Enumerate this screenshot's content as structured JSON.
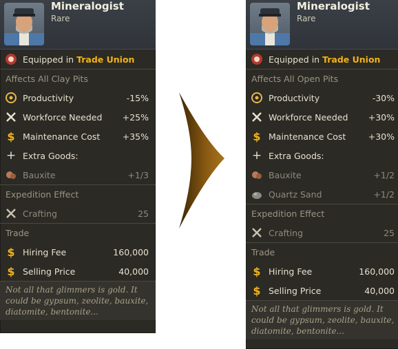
{
  "left": {
    "name": "Mineralogist",
    "rarity": "Rare",
    "equipped_prefix": "Equipped in",
    "equipped_target": "Trade Union",
    "affects": "Affects All Clay Pits",
    "stats": [
      {
        "label": "Productivity",
        "value": "-15%",
        "icon": "gear-icon"
      },
      {
        "label": "Workforce Needed",
        "value": "+25%",
        "icon": "hammer-wrench-icon"
      },
      {
        "label": "Maintenance Cost",
        "value": "+35%",
        "icon": "dollar-icon"
      }
    ],
    "extra_goods_label": "Extra Goods:",
    "goods": [
      {
        "label": "Bauxite",
        "value": "+1/3",
        "icon": "bauxite-icon"
      }
    ],
    "expedition_label": "Expedition Effect",
    "expedition": {
      "label": "Crafting",
      "value": "25"
    },
    "trade_label": "Trade",
    "hiring_fee_label": "Hiring Fee",
    "hiring_fee": "160,000",
    "selling_price_label": "Selling Price",
    "selling_price": "40,000",
    "flavor": "Not all that glimmers is gold. It could be gypsum, zeolite, bauxite, diatomite, bentonite..."
  },
  "right": {
    "name": "Mineralogist",
    "rarity": "Rare",
    "equipped_prefix": "Equipped in",
    "equipped_target": "Trade Union",
    "affects": "Affects All Open Pits",
    "stats": [
      {
        "label": "Productivity",
        "value": "-30%",
        "icon": "gear-icon"
      },
      {
        "label": "Workforce Needed",
        "value": "+30%",
        "icon": "hammer-wrench-icon"
      },
      {
        "label": "Maintenance Cost",
        "value": "+30%",
        "icon": "dollar-icon"
      }
    ],
    "extra_goods_label": "Extra Goods:",
    "goods": [
      {
        "label": "Bauxite",
        "value": "+1/2",
        "icon": "bauxite-icon"
      },
      {
        "label": "Quartz Sand",
        "value": "+1/2",
        "icon": "quartz-sand-icon"
      }
    ],
    "expedition_label": "Expedition Effect",
    "expedition": {
      "label": "Crafting",
      "value": "25"
    },
    "trade_label": "Trade",
    "hiring_fee_label": "Hiring Fee",
    "hiring_fee": "160,000",
    "selling_price_label": "Selling Price",
    "selling_price": "40,000",
    "flavor": "Not all that glimmers is gold. It could be gypsum, zeolite, bauxite, diatomite, bentonite..."
  },
  "colors": {
    "accent": "#f2b21c",
    "panel": "#2b2a25",
    "arrow": "#8a5a12"
  }
}
